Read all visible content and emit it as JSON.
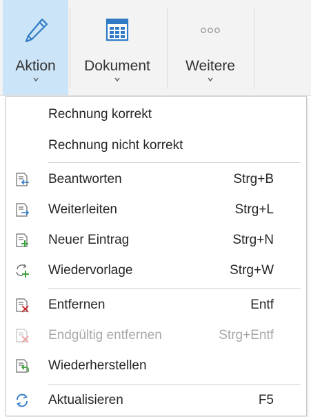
{
  "ribbon": {
    "buttons": [
      {
        "label": "Aktion",
        "icon": "pencil-icon",
        "active": true
      },
      {
        "label": "Dokument",
        "icon": "document-grid-icon",
        "active": false
      },
      {
        "label": "Weitere",
        "icon": "more-dots-icon",
        "active": false
      }
    ]
  },
  "menu": {
    "items": [
      {
        "label": "Rechnung korrekt",
        "shortcut": "",
        "icon": "",
        "disabled": false
      },
      {
        "label": "Rechnung nicht korrekt",
        "shortcut": "",
        "icon": "",
        "disabled": false
      },
      {
        "label": "Beantworten",
        "shortcut": "Strg+B",
        "icon": "reply-icon",
        "disabled": false
      },
      {
        "label": "Weiterleiten",
        "shortcut": "Strg+L",
        "icon": "forward-icon",
        "disabled": false
      },
      {
        "label": "Neuer Eintrag",
        "shortcut": "Strg+N",
        "icon": "new-entry-icon",
        "disabled": false
      },
      {
        "label": "Wiedervorlage",
        "shortcut": "Strg+W",
        "icon": "resubmission-icon",
        "disabled": false
      },
      {
        "label": "Entfernen",
        "shortcut": "Entf",
        "icon": "remove-icon",
        "disabled": false
      },
      {
        "label": "Endgültig entfernen",
        "shortcut": "Strg+Entf",
        "icon": "remove-permanently-icon",
        "disabled": true
      },
      {
        "label": "Wiederherstellen",
        "shortcut": "",
        "icon": "restore-icon",
        "disabled": false
      },
      {
        "label": "Aktualisieren",
        "shortcut": "F5",
        "icon": "refresh-icon",
        "disabled": false
      }
    ]
  },
  "colors": {
    "ribbon_active": "#cce4f7",
    "icon_blue": "#2f7bc6",
    "icon_green": "#3aa23a",
    "icon_red": "#d7262a",
    "disabled_text": "#a8a8a8"
  }
}
